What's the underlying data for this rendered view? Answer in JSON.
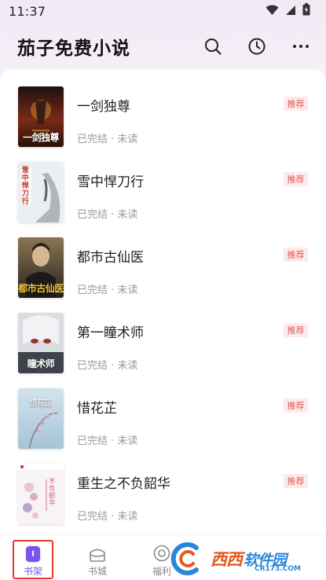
{
  "status_bar": {
    "time": "11:37"
  },
  "header": {
    "title": "茄子免费小说",
    "actions": [
      "search-icon",
      "history-icon",
      "more-icon"
    ]
  },
  "books": [
    {
      "title": "一剑独尊",
      "meta": "已完结 · 未读",
      "tag": "推荐",
      "cover_text": "一剑独尊",
      "cover_colors": [
        "#2a1410",
        "#8b2b18",
        "#f0a33a"
      ]
    },
    {
      "title": "雪中悍刀行",
      "meta": "已完结 · 未读",
      "tag": "推荐",
      "cover_text": "雪中悍刀行",
      "cover_colors": [
        "#e9ecef",
        "#9aa4ad",
        "#c33a2b"
      ]
    },
    {
      "title": "都市古仙医",
      "meta": "已完结 · 未读",
      "tag": "推荐",
      "cover_text": "都市古仙医",
      "cover_colors": [
        "#6b5a3f",
        "#2e2a24",
        "#e9b93a"
      ]
    },
    {
      "title": "第一瞳术师",
      "meta": "已完结 · 未读",
      "tag": "推荐",
      "cover_text": "瞳术师",
      "cover_colors": [
        "#dadde2",
        "#5a5f68",
        "#b23434"
      ]
    },
    {
      "title": "惜花芷",
      "meta": "已完结 · 未读",
      "tag": "推荐",
      "cover_text": "惜花芷",
      "cover_colors": [
        "#cfe0ec",
        "#a9c5d9",
        "#d48ba0"
      ]
    },
    {
      "title": "重生之不负韶华",
      "meta": "已完结 · 未读",
      "tag": "推荐",
      "cover_text": "不负韶华",
      "cover_colors": [
        "#f7f2f4",
        "#e5c9d2",
        "#c7547a"
      ]
    }
  ],
  "tabs": [
    {
      "label": "书架",
      "icon": "bookshelf-icon",
      "active": true
    },
    {
      "label": "书城",
      "icon": "bookstore-icon",
      "active": false
    },
    {
      "label": "福利",
      "icon": "welfare-icon",
      "active": false
    }
  ],
  "watermark": {
    "text1": "西西",
    "text2": "软件园",
    "url": "CR173.COM"
  },
  "colors": {
    "accent": "#7a54f3",
    "tag_text": "#e85a5a",
    "tag_bg": "#fdeaea",
    "highlight_border": "#e33a2e"
  }
}
